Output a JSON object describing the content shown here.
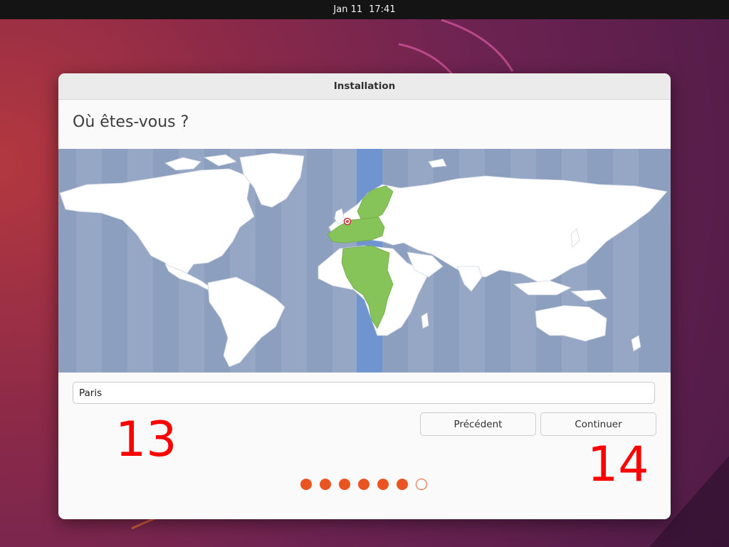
{
  "topbar": {
    "date": "Jan 11",
    "time": "17:41"
  },
  "window": {
    "title": "Installation"
  },
  "page": {
    "heading": "Où êtes-vous ?"
  },
  "location": {
    "value": "Paris"
  },
  "buttons": {
    "previous": "Précédent",
    "continue": "Continuer"
  },
  "progress": {
    "total_steps": 7,
    "completed_steps": 6
  },
  "annotations": {
    "left": "13",
    "right": "14"
  },
  "colors": {
    "accent": "#e95420",
    "map_ocean": "#8c9fbf",
    "selected_zone": "#7094cf",
    "selected_countries": "#86c45a"
  }
}
